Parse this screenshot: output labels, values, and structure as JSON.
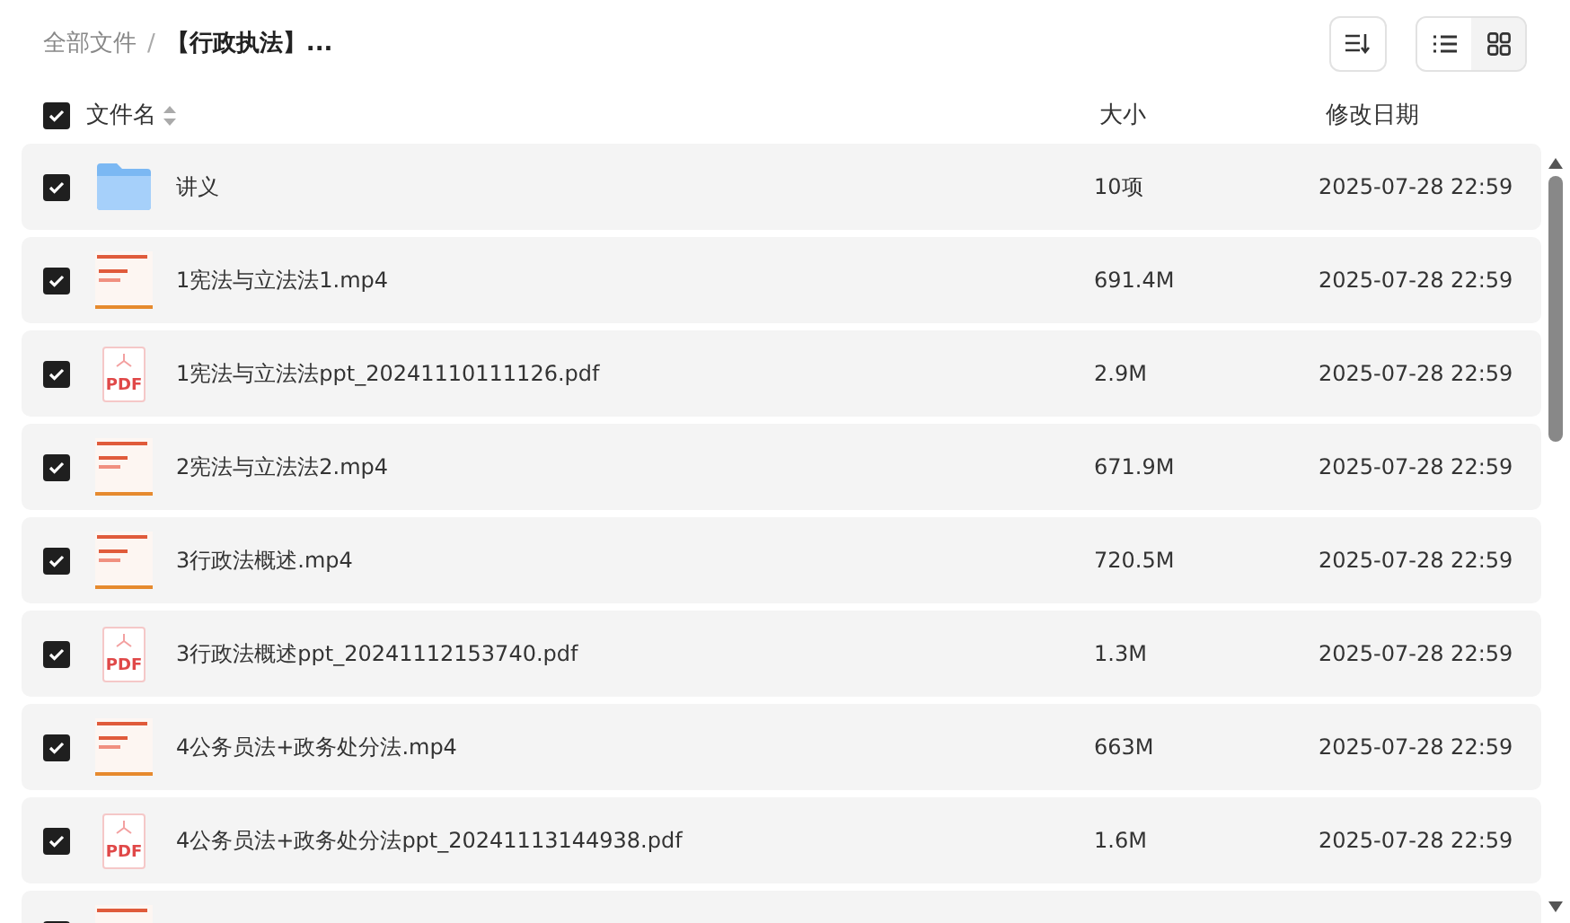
{
  "breadcrumb": {
    "root": "全部文件",
    "separator": "/",
    "current": "【行政执法】..."
  },
  "view_toggle": [
    {
      "kind": "list",
      "selected": true
    },
    {
      "kind": "grid",
      "selected": false
    }
  ],
  "columns": {
    "all_checked": true,
    "name": "文件名",
    "size": "大小",
    "date": "修改日期"
  },
  "files": [
    {
      "kind": "folder",
      "checked": true,
      "name": "讲义",
      "size": "10项",
      "date": "2025-07-28 22:59"
    },
    {
      "kind": "video",
      "checked": true,
      "name": "1宪法与立法法1.mp4",
      "size": "691.4M",
      "date": "2025-07-28 22:59"
    },
    {
      "kind": "pdf",
      "badge": "PDF",
      "checked": true,
      "name": "1宪法与立法法ppt_20241110111126.pdf",
      "size": "2.9M",
      "date": "2025-07-28 22:59"
    },
    {
      "kind": "video",
      "checked": true,
      "name": "2宪法与立法法2.mp4",
      "size": "671.9M",
      "date": "2025-07-28 22:59"
    },
    {
      "kind": "video",
      "checked": true,
      "name": "3行政法概述.mp4",
      "size": "720.5M",
      "date": "2025-07-28 22:59"
    },
    {
      "kind": "pdf",
      "badge": "PDF",
      "checked": true,
      "name": "3行政法概述ppt_20241112153740.pdf",
      "size": "1.3M",
      "date": "2025-07-28 22:59"
    },
    {
      "kind": "video",
      "checked": true,
      "name": "4公务员法+政务处分法.mp4",
      "size": "663M",
      "date": "2025-07-28 22:59"
    },
    {
      "kind": "pdf",
      "badge": "PDF",
      "checked": true,
      "name": "4公务员法+政务处分法ppt_20241113144938.pdf",
      "size": "1.6M",
      "date": "2025-07-28 22:59"
    },
    {
      "kind": "video",
      "checked": true
    }
  ]
}
